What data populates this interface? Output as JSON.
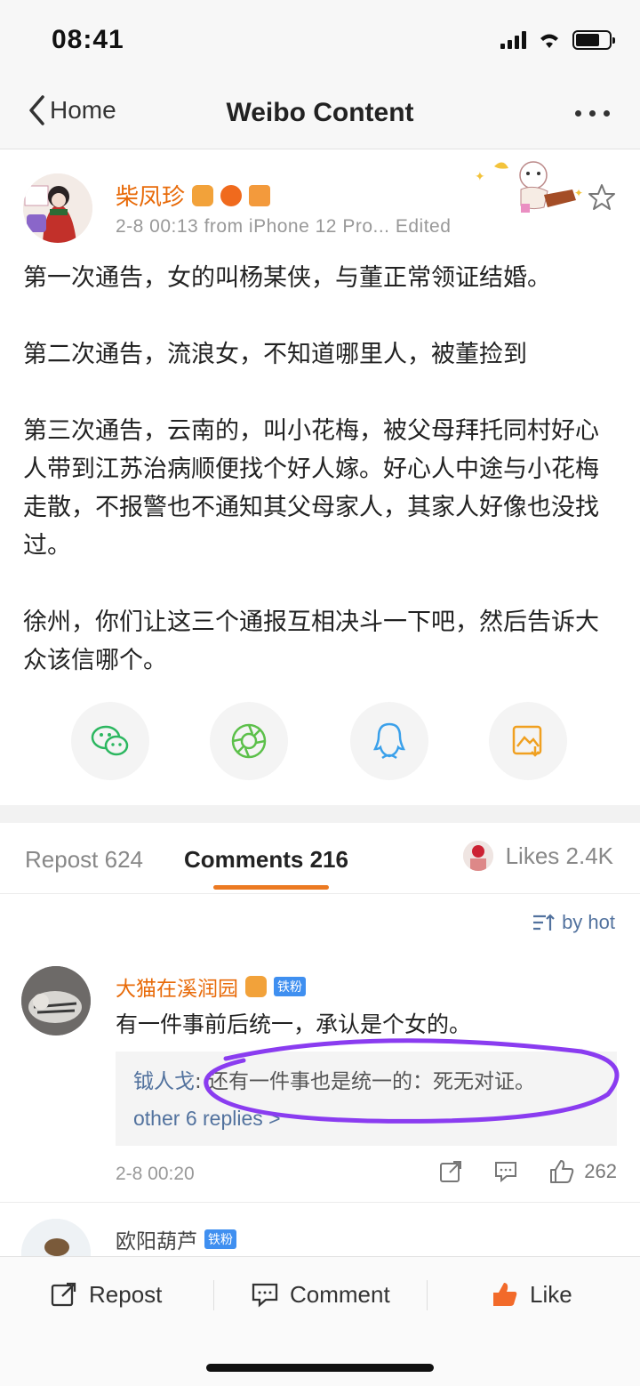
{
  "status": {
    "time": "08:41"
  },
  "nav": {
    "back_label": "Home",
    "title": "Weibo Content"
  },
  "post": {
    "author": "柴凤珍",
    "meta": "2-8 00:13  from iPhone 12 Pro...  Edited",
    "paragraphs": [
      "第一次通告，女的叫杨某侠，与董正常领证结婚。",
      "第二次通告，流浪女，不知道哪里人，被董捡到",
      "第三次通告，云南的，叫小花梅，被父母拜托同村好心人带到江苏治病顺便找个好人嫁。好心人中途与小花梅走散，不报警也不通知其父母家人，其家人好像也没找过。",
      "徐州，你们让这三个通报互相决斗一下吧，然后告诉大众该信哪个。"
    ],
    "share_icons": [
      "wechat-icon",
      "moments-icon",
      "qq-icon",
      "save-image-icon"
    ]
  },
  "tabs": {
    "repost": "Repost 624",
    "comments": "Comments 216",
    "likes": "Likes 2.4K"
  },
  "sort": {
    "label": "by hot"
  },
  "comment": {
    "author": "大猫在溪润园",
    "fan_badge": "铁粉",
    "text": "有一件事前后统一，承认是个女的。",
    "reply_author": "钺人戈",
    "reply_text": ": 还有一件事也是统一的：死无对证。",
    "more_replies": "other 6 replies >",
    "time": "2-8 00:20",
    "like_count": "262"
  },
  "comment2": {
    "author": "欧阳葫芦",
    "fan_badge": "铁粉"
  },
  "bottom": {
    "repost": "Repost",
    "comment": "Comment",
    "like": "Like"
  },
  "colors": {
    "accent": "#ec7a22",
    "link": "#52729e",
    "username": "#e86b0a",
    "annotation": "#8a3cf0"
  }
}
